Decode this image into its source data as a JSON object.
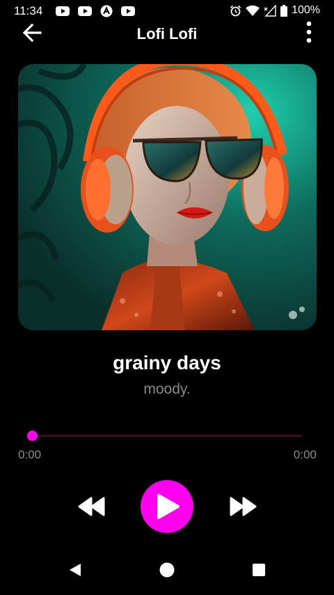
{
  "status_bar": {
    "time": "11:34",
    "battery": "100%",
    "notification_icons": [
      "youtube-icon",
      "youtube-icon",
      "app-icon",
      "youtube-icon"
    ],
    "system_icons": [
      "alarm-icon",
      "wifi-icon",
      "no-signal-icon",
      "battery-icon"
    ]
  },
  "app_bar": {
    "title": "Lofi Lofi",
    "back_icon": "arrow-left-icon",
    "menu_icon": "more-vert-icon"
  },
  "album_art": {
    "description_icon": "album-cover-image"
  },
  "track": {
    "title": "grainy days",
    "artist": "moody."
  },
  "playback": {
    "elapsed": "0:00",
    "total": "0:00",
    "progress": 0.0
  },
  "controls": {
    "rewind_icon": "fast-rewind-icon",
    "play_icon": "play-icon",
    "forward_icon": "fast-forward-icon"
  },
  "nav_bar": {
    "back_icon": "nav-back-icon",
    "home_icon": "nav-home-icon",
    "recents_icon": "nav-recents-icon"
  },
  "colors": {
    "accent": "#ff00ee",
    "background": "#000000",
    "text_primary": "#ffffff",
    "text_secondary": "#8a8a8a",
    "seek_track": "#3a0d1c"
  }
}
